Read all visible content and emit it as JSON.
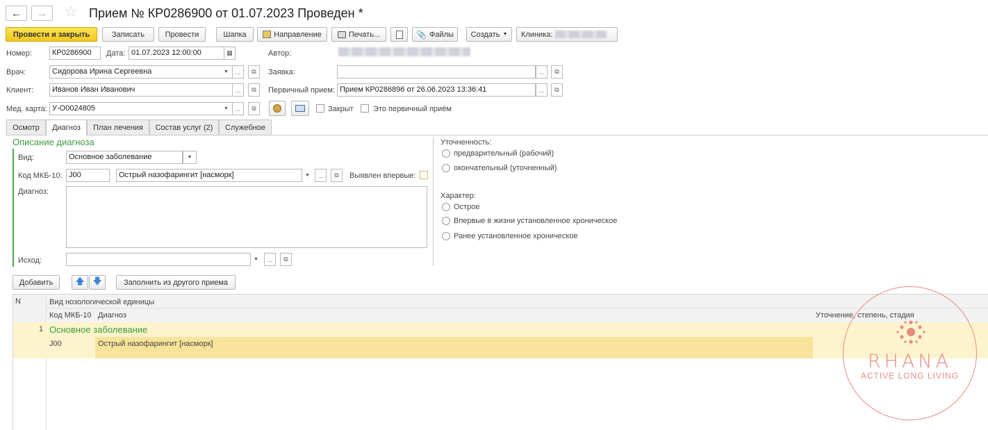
{
  "window": {
    "title": "Прием № КР0286900 от 01.07.2023 Проведен *"
  },
  "toolbar": {
    "post_close": "Провести и закрыть",
    "save": "Записать",
    "post": "Провести",
    "header": "Шапка",
    "referral": "Направление",
    "print": "Печать...",
    "files": "Файлы",
    "create": "Создать",
    "clinic_label": "Клиника:"
  },
  "header": {
    "number_label": "Номер:",
    "number_value": "КР0286900",
    "date_label": "Дата:",
    "date_value": "01.07.2023 12:00:00",
    "author_label": "Автор:",
    "doctor_label": "Врач:",
    "doctor_value": "Сидорова Ирина Сергеевна",
    "request_label": "Заявка:",
    "request_value": "",
    "client_label": "Клиент:",
    "client_value": "Иванов Иван Иванович",
    "primary_label": "Первичный прием:",
    "primary_value": "Прием КР0286896 от 26.06.2023 13:36:41",
    "medcard_label": "Мед. карта:",
    "medcard_value": "У-О0024805",
    "closed_label": "Закрыт",
    "first_visit_label": "Это первичный приём"
  },
  "tabs": [
    {
      "label": "Осмотр",
      "active": false
    },
    {
      "label": "Диагноз",
      "active": true
    },
    {
      "label": "План лечения",
      "active": false
    },
    {
      "label": "Состав услуг (2)",
      "active": false
    },
    {
      "label": "Служебное",
      "active": false
    }
  ],
  "diagnosis": {
    "section_title": "Описание диагноза",
    "kind_label": "Вид:",
    "kind_value": "Основное заболевание",
    "mkb_label": "Код МКБ-10:",
    "mkb_code": "J00",
    "mkb_name": "Острый назофарингит [насморк]",
    "first_detected_label": "Выявлен впервые:",
    "diagnosis_label": "Диагноз:",
    "diagnosis_value": "",
    "outcome_label": "Исход:",
    "outcome_value": ""
  },
  "accuracy": {
    "label": "Уточненность:",
    "options": [
      "предварительный (рабочий)",
      "окончательный (уточненный)"
    ]
  },
  "character": {
    "label": "Характер:",
    "options": [
      "Острое",
      "Впервые в жизни установленное хроническое",
      "Ранее установленное хроническое"
    ]
  },
  "list_toolbar": {
    "add": "Добавить",
    "fill_from": "Заполнить из другого приема"
  },
  "table": {
    "col_n": "N",
    "col_kind": "Вид нозологической единицы",
    "col_code": "Код МКБ-10",
    "col_diag": "Диагноз",
    "col_spec": "Уточнение, степень, стадия",
    "rows": [
      {
        "n": "1",
        "kind": "Основное заболевание",
        "code": "J00",
        "diag": "Острый назофарингит [насморк]",
        "spec": ""
      }
    ]
  },
  "watermark": {
    "name": "RHANA",
    "tagline": "ACTIVE LONG LIVING"
  },
  "colors": {
    "primary_button": "#f2c91c",
    "section_green": "#3a9a3a",
    "row_highlight": "#fdf4cd",
    "row_selected": "#f8e39b",
    "watermark": "#e88a82"
  }
}
